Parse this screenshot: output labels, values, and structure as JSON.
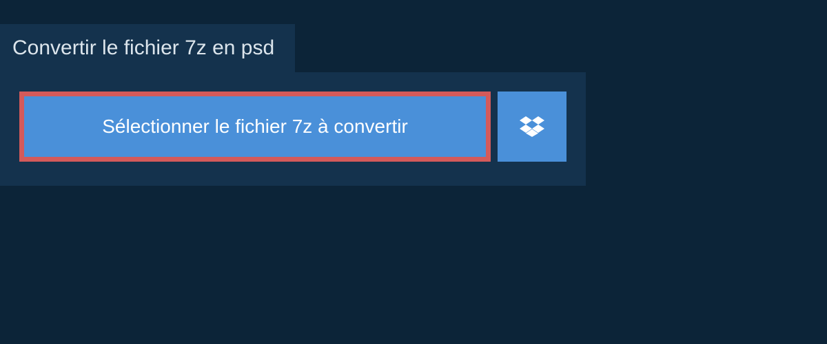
{
  "tab": {
    "title": "Convertir le fichier 7z en psd"
  },
  "panel": {
    "select_button_label": "Sélectionner le fichier 7z à convertir"
  },
  "colors": {
    "background": "#0c2438",
    "panel": "#14324d",
    "button": "#4a90d9",
    "highlight_border": "#d45a5a",
    "text_light": "#dce5ec",
    "text_white": "#ffffff"
  }
}
